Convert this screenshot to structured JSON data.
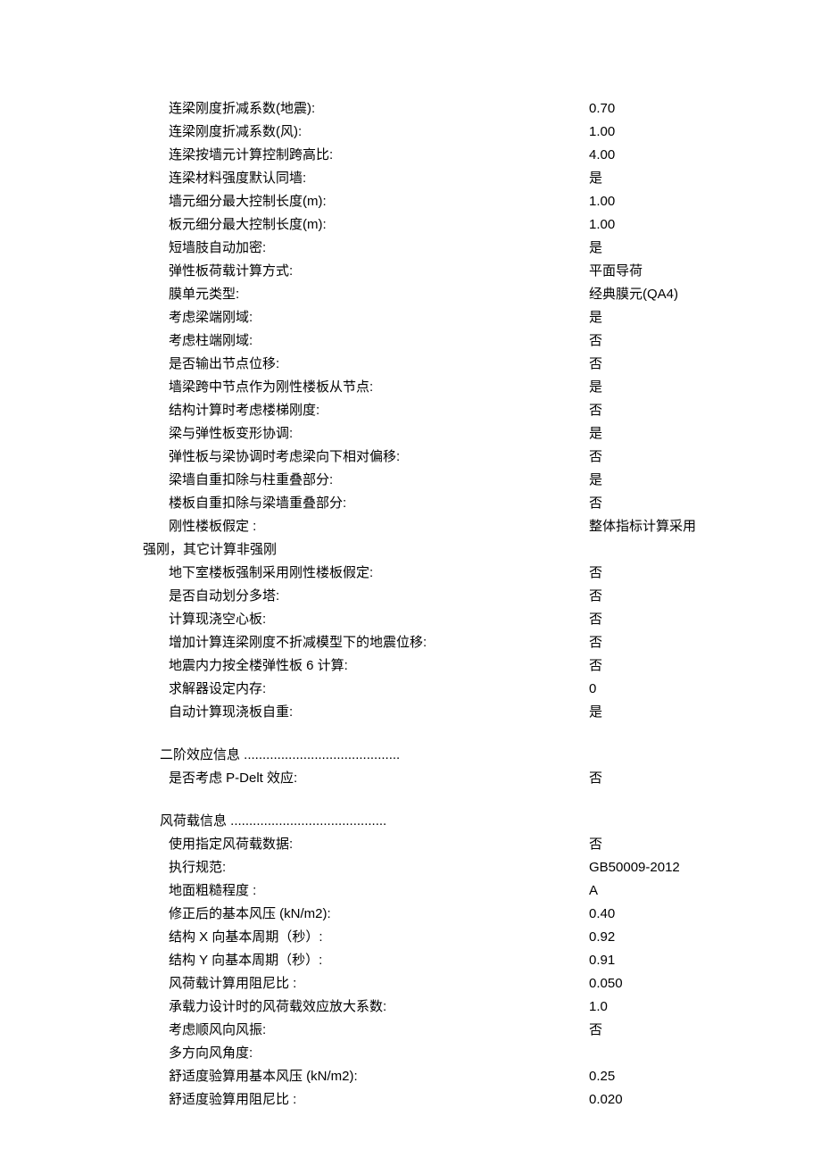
{
  "section1": {
    "rows": [
      {
        "label": "连梁刚度折减系数(地震):",
        "value": "0.70"
      },
      {
        "label": "连梁刚度折减系数(风):",
        "value": "1.00"
      },
      {
        "label": "连梁按墙元计算控制跨高比:",
        "value": "4.00"
      },
      {
        "label": "连梁材料强度默认同墙:",
        "value": "是"
      },
      {
        "label": "墙元细分最大控制长度(m):",
        "value": "1.00"
      },
      {
        "label": "板元细分最大控制长度(m):",
        "value": "1.00"
      },
      {
        "label": "短墙肢自动加密:",
        "value": "是"
      },
      {
        "label": "弹性板荷载计算方式:",
        "value": "平面导荷"
      },
      {
        "label": "膜单元类型:",
        "value": "经典膜元(QA4)"
      },
      {
        "label": "考虑梁端刚域:",
        "value": "是"
      },
      {
        "label": "考虑柱端刚域:",
        "value": "否"
      },
      {
        "label": "是否输出节点位移:",
        "value": "否"
      },
      {
        "label": "墙梁跨中节点作为刚性楼板从节点:",
        "value": "是"
      },
      {
        "label": "结构计算时考虑楼梯刚度:",
        "value": "否"
      },
      {
        "label": "梁与弹性板变形协调:",
        "value": "是"
      },
      {
        "label": "弹性板与梁协调时考虑梁向下相对偏移:",
        "value": "否"
      },
      {
        "label": "梁墙自重扣除与柱重叠部分:",
        "value": "是"
      },
      {
        "label": "楼板自重扣除与梁墙重叠部分:",
        "value": "否"
      }
    ],
    "wrap_row": {
      "label": "刚性楼板假定  :",
      "value_prefix": "整体指标计算采用",
      "value_line2": "强刚，其它计算非强刚"
    },
    "rows2": [
      {
        "label": "地下室楼板强制采用刚性楼板假定:",
        "value": "否"
      },
      {
        "label": "是否自动划分多塔:",
        "value": "否"
      },
      {
        "label": "计算现浇空心板:",
        "value": "否"
      },
      {
        "label": "增加计算连梁刚度不折减模型下的地震位移:",
        "value": "否"
      },
      {
        "label": "地震内力按全楼弹性板 6 计算:",
        "value": "否"
      },
      {
        "label": "求解器设定内存:",
        "value": "0"
      },
      {
        "label": "自动计算现浇板自重:",
        "value": "是"
      }
    ]
  },
  "section2": {
    "header": "二阶效应信息  ..........................................",
    "rows": [
      {
        "label": "是否考虑  P-Delt  效应:",
        "value": "否"
      }
    ]
  },
  "section3": {
    "header": "风荷载信息  ..........................................",
    "rows": [
      {
        "label": "使用指定风荷载数据:",
        "value": "否"
      },
      {
        "label": "执行规范:",
        "value": "GB50009-2012"
      },
      {
        "label": "地面粗糙程度  :",
        "value": "A"
      },
      {
        "label": "修正后的基本风压  (kN/m2):",
        "value": "0.40"
      },
      {
        "label": "结构 X 向基本周期（秒）:",
        "value": "0.92"
      },
      {
        "label": "结构 Y 向基本周期（秒）:",
        "value": "0.91"
      },
      {
        "label": "风荷载计算用阻尼比  :",
        "value": "0.050"
      },
      {
        "label": "承载力设计时的风荷载效应放大系数:",
        "value": "1.0"
      },
      {
        "label": "考虑顺风向风振:",
        "value": "否"
      },
      {
        "label": "多方向风角度:",
        "value": ""
      },
      {
        "label": "舒适度验算用基本风压  (kN/m2):",
        "value": "0.25"
      },
      {
        "label": "舒适度验算用阻尼比  :",
        "value": "0.020"
      }
    ]
  }
}
